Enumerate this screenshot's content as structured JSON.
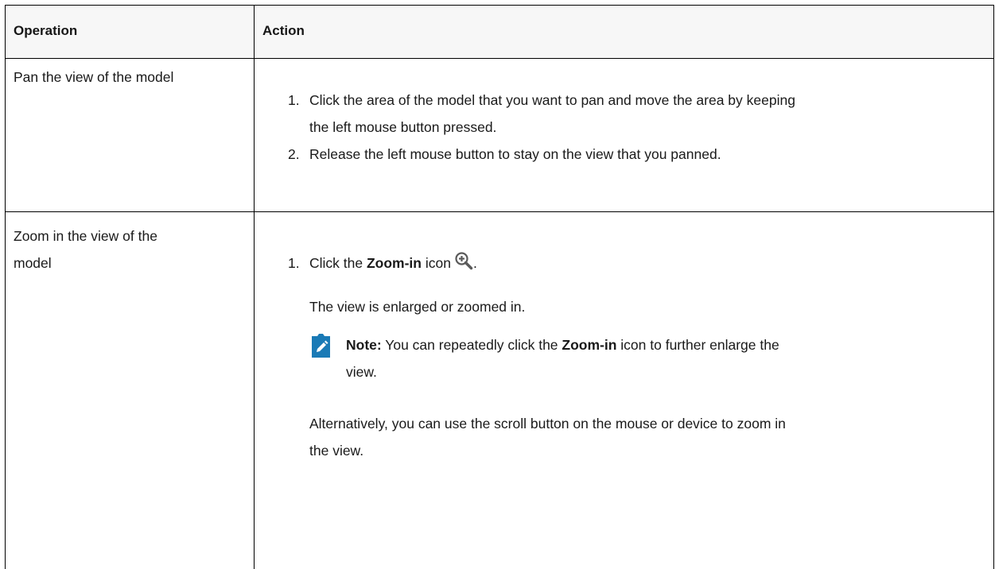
{
  "headers": {
    "operation": "Operation",
    "action": "Action"
  },
  "rows": [
    {
      "operation": "Pan the view of the model",
      "steps": [
        {
          "num": "1.",
          "line1": "Click the area of the model that you want to pan and move the area by keeping",
          "line2": "the left mouse button pressed."
        },
        {
          "num": "2.",
          "line1": "Release the left mouse button to stay on the view that you panned."
        }
      ]
    },
    {
      "operation_line1": "Zoom in the view of the",
      "operation_line2": "model",
      "step1": {
        "num": "1.",
        "prefix": "Click the ",
        "bold": "Zoom-in",
        "suffix": " icon",
        "end": "."
      },
      "result": "The view is enlarged or zoomed in.",
      "note": {
        "label": "Note:",
        "prefix": " You can repeatedly click the ",
        "bold": "Zoom-in",
        "suffix": " icon to further enlarge the",
        "line2": "view."
      },
      "alt_line1": "Alternatively, you can use the scroll button on the mouse or device to zoom in",
      "alt_line2": "the view."
    }
  ],
  "icons": {
    "zoom": "zoom-in-icon",
    "note": "note-icon"
  },
  "colors": {
    "note_blue": "#1a7ab6",
    "icon_grey": "#5a5a5a"
  }
}
